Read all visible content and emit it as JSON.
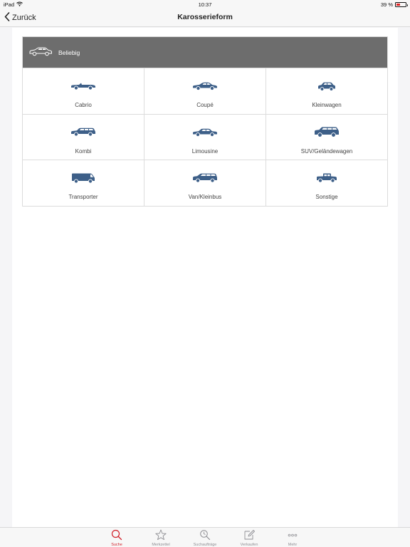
{
  "status_bar": {
    "device": "iPad",
    "time": "10:37",
    "battery": "39 %",
    "battery_level": 0.39
  },
  "nav": {
    "back_label": "Zurück",
    "title": "Karosserieform"
  },
  "any_option": {
    "label": "Beliebig",
    "icon": "car-outline-icon"
  },
  "body_types": [
    {
      "label": "Cabrio",
      "icon": "cabrio-icon"
    },
    {
      "label": "Coupé",
      "icon": "coupe-icon"
    },
    {
      "label": "Kleinwagen",
      "icon": "kleinwagen-icon"
    },
    {
      "label": "Kombi",
      "icon": "kombi-icon"
    },
    {
      "label": "Limousine",
      "icon": "limousine-icon"
    },
    {
      "label": "SUV/Geländewagen",
      "icon": "suv-icon"
    },
    {
      "label": "Transporter",
      "icon": "transporter-icon"
    },
    {
      "label": "Van/Kleinbus",
      "icon": "van-icon"
    },
    {
      "label": "Sonstige",
      "icon": "sonstige-icon"
    }
  ],
  "tabs": [
    {
      "label": "Suche",
      "icon": "search-icon",
      "active": true
    },
    {
      "label": "Merkzettel",
      "icon": "star-icon",
      "active": false
    },
    {
      "label": "Suchaufträge",
      "icon": "saved-search-icon",
      "active": false
    },
    {
      "label": "Verkaufen",
      "icon": "edit-icon",
      "active": false
    },
    {
      "label": "Mehr",
      "icon": "more-icon",
      "active": false
    }
  ],
  "colors": {
    "icon_blue": "#3d5f88",
    "accent_red": "#d0202a",
    "any_bg": "#6d6d6d"
  }
}
